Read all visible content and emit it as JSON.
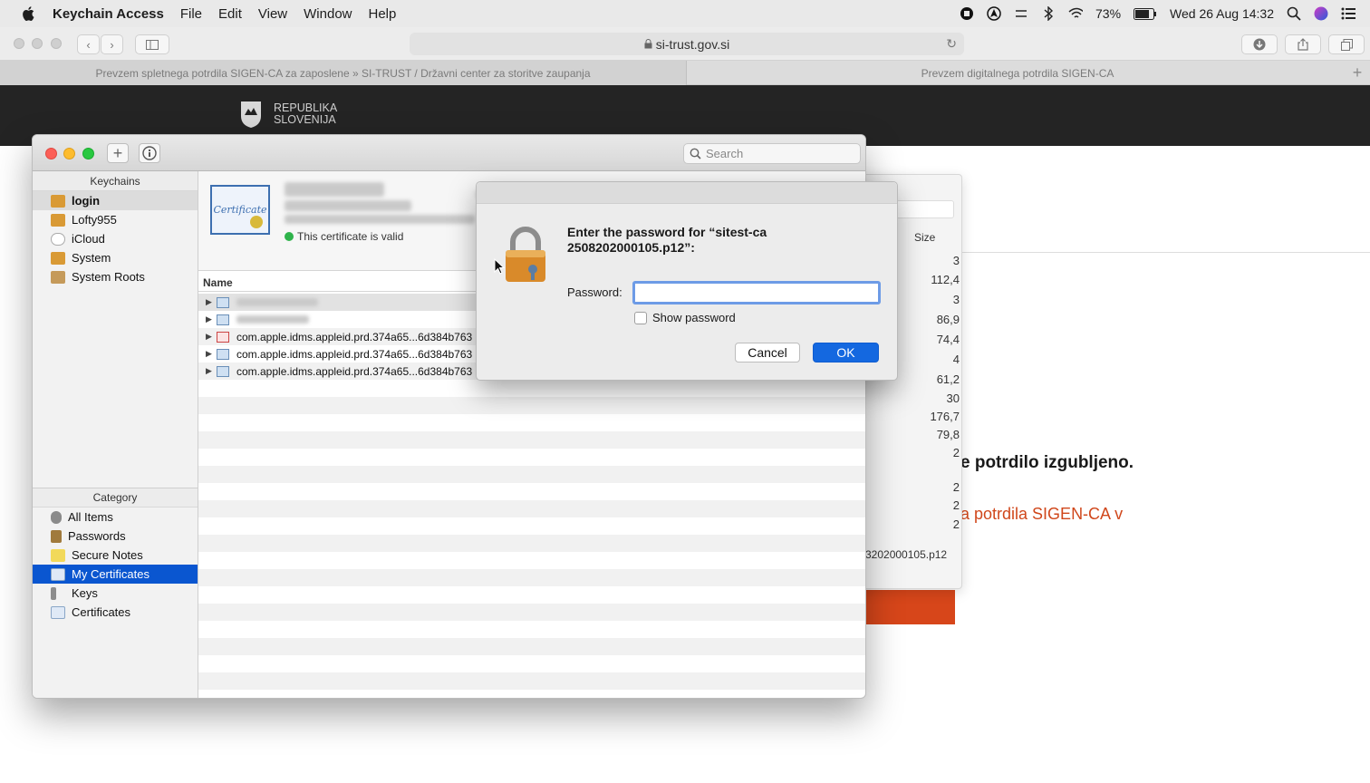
{
  "menubar": {
    "app_name": "Keychain Access",
    "menus": [
      "File",
      "Edit",
      "View",
      "Window",
      "Help"
    ],
    "battery": "73%",
    "datetime": "Wed 26 Aug  14:32"
  },
  "safari": {
    "url": "si-trust.gov.si",
    "tabs": [
      {
        "label": "Prevzem spletnega potrdila SIGEN-CA za zaposlene » SI-TRUST / Državni center za storitve zaupanja"
      },
      {
        "label": "Prevzem digitalnega potrdila SIGEN-CA"
      }
    ],
    "new_tab": "+"
  },
  "page": {
    "logo_line1": "REPUBLIKA",
    "logo_line2": "SLOVENIJA",
    "text_bold": "e potrdilo izgubljeno.",
    "text_link": "a potrdila SIGEN-CA v"
  },
  "bg_panel": {
    "size_header": "Size",
    "sizes": [
      "3",
      "112,4",
      "3",
      "86,9",
      "74,4",
      "4",
      "61,2",
      "30",
      "176,7",
      "79,8",
      "2",
      "2",
      "2",
      "2"
    ],
    "filename": "3202000105.p12"
  },
  "keychain": {
    "search_placeholder": "Search",
    "keychains_header": "Keychains",
    "keychains": [
      {
        "label": "login"
      },
      {
        "label": "Lofty955"
      },
      {
        "label": "iCloud"
      },
      {
        "label": "System"
      },
      {
        "label": "System Roots"
      }
    ],
    "category_header": "Category",
    "categories": [
      {
        "label": "All Items"
      },
      {
        "label": "Passwords"
      },
      {
        "label": "Secure Notes"
      },
      {
        "label": "My Certificates"
      },
      {
        "label": "Keys"
      },
      {
        "label": "Certificates"
      }
    ],
    "cert_image_text": "Certificate",
    "cert_valid": "This certificate is valid",
    "column_name": "Name",
    "rows": [
      {
        "name": ""
      },
      {
        "name": ""
      },
      {
        "name": "com.apple.idms.appleid.prd.374a65...6d384b763"
      },
      {
        "name": "com.apple.idms.appleid.prd.374a65...6d384b763"
      },
      {
        "name": "com.apple.idms.appleid.prd.374a65...6d384b763"
      }
    ]
  },
  "dialog": {
    "title": "Enter the password for “sitest-ca 2508202000105.p12”:",
    "password_label": "Password:",
    "password_value": "",
    "show_password": "Show password",
    "cancel": "Cancel",
    "ok": "OK"
  },
  "colors": {
    "accent": "#1468e0",
    "selection": "#0a56d0",
    "brand_orange": "#d7461a"
  }
}
